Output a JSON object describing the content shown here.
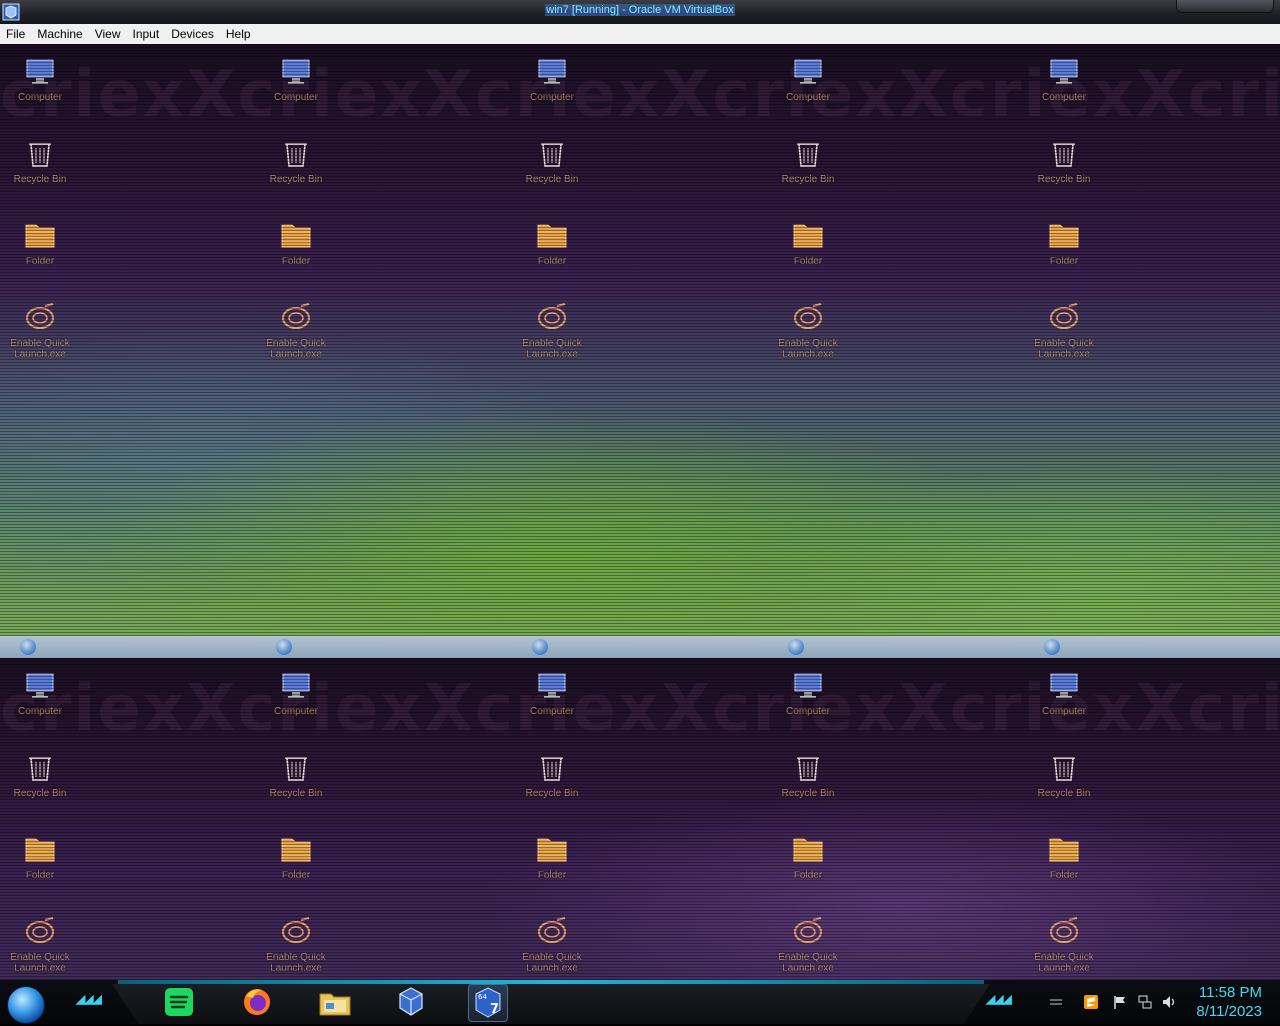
{
  "window": {
    "title": "win7 [Running] - Oracle VM VirtualBox",
    "app_icon": "virtualbox-icon"
  },
  "menubar": {
    "items": [
      {
        "label": "File"
      },
      {
        "label": "Machine"
      },
      {
        "label": "View"
      },
      {
        "label": "Input"
      },
      {
        "label": "Devices"
      },
      {
        "label": "Help"
      }
    ]
  },
  "vm_desktop": {
    "watermark": "criexXcriexXcriexXcriexXcriexXcriexX",
    "icons": [
      {
        "label": "Computer",
        "icon": "computer-icon"
      },
      {
        "label": "Recycle Bin",
        "icon": "recycle-bin-icon"
      },
      {
        "label": "Folder",
        "icon": "folder-icon"
      },
      {
        "label": "Enable Quick Launch.exe",
        "icon": "enable-quick-launch-icon"
      }
    ],
    "columns": 5
  },
  "taskbar": {
    "start_button": "start-orb-icon",
    "apps": [
      {
        "name": "Spotify",
        "icon": "spotify-icon"
      },
      {
        "name": "Firefox",
        "icon": "firefox-icon"
      },
      {
        "name": "File Explorer",
        "icon": "file-explorer-icon"
      },
      {
        "name": "VirtualBox",
        "icon": "virtualbox-icon"
      },
      {
        "name": "Windows 7 VM",
        "icon": "win7-vm-icon"
      }
    ],
    "tray": [
      {
        "icon": "show-hidden-icon"
      },
      {
        "icon": "sublime-icon"
      },
      {
        "icon": "action-center-flag-icon"
      },
      {
        "icon": "network-icon"
      },
      {
        "icon": "volume-icon"
      }
    ],
    "clock": {
      "time": "11:58 PM",
      "date": "8/11/2023"
    }
  }
}
